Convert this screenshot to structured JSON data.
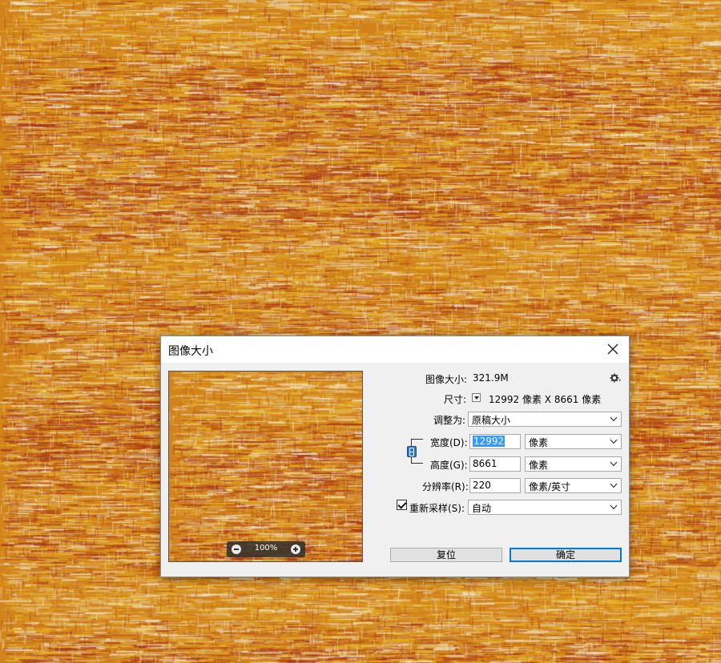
{
  "dialog": {
    "title": "图像大小",
    "image_size_label": "图像大小:",
    "image_size_value": "321.9M",
    "dimensions_label": "尺寸:",
    "dimensions_value": "12992 像素  X  8661 像素",
    "fit_to_label": "调整为:",
    "fit_to_value": "原稿大小",
    "width_label": "宽度(D):",
    "width_value": "12992",
    "width_unit": "像素",
    "height_label": "高度(G):",
    "height_value": "8661",
    "height_unit": "像素",
    "resolution_label": "分辨率(R):",
    "resolution_value": "220",
    "resolution_unit": "像素/英寸",
    "resample_label": "重新采样(S):",
    "resample_checked": true,
    "resample_value": "自动",
    "reset_label": "复位",
    "ok_label": "确定"
  },
  "preview": {
    "zoom": "100%"
  },
  "colors": {
    "texture_orange": "#d2841c",
    "texture_red": "#a8361a",
    "texture_yellow": "#e8b62a",
    "texture_cream": "#efe6d2",
    "accent_blue": "#0078d7"
  }
}
